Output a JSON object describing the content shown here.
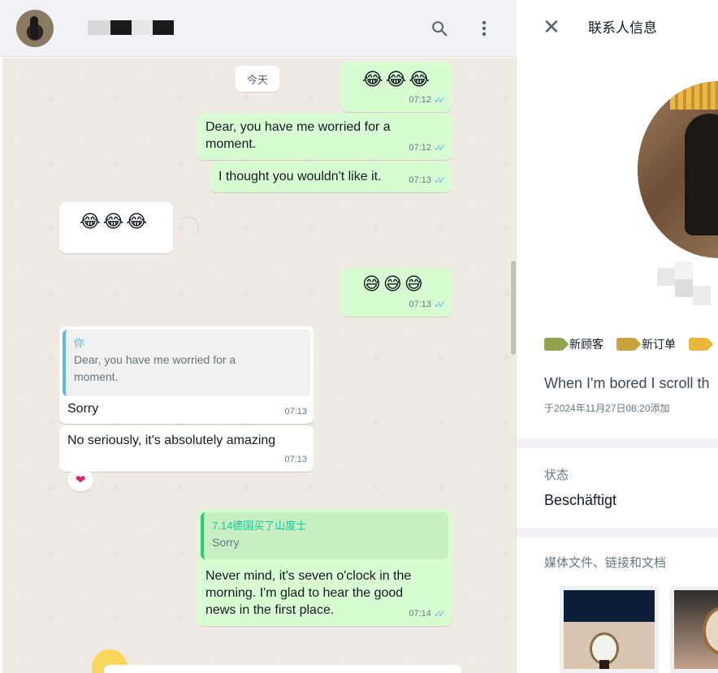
{
  "header": {
    "search_icon": "search-icon",
    "menu_icon": "more-vertical-icon"
  },
  "chat": {
    "date_chip": "今天",
    "messages": [
      {
        "direction": "out",
        "emoji": "😂😂😂",
        "time": "07:12"
      },
      {
        "direction": "out",
        "text": "Dear, you have me worried for a moment.",
        "time": "07:12"
      },
      {
        "direction": "out",
        "text": "I thought you wouldn't like it.",
        "time": "07:13"
      },
      {
        "direction": "in",
        "emoji": "😂😂😂"
      },
      {
        "direction": "out",
        "emoji": "😅😅😅",
        "time": "07:13"
      },
      {
        "direction": "in",
        "quote_author": "你",
        "quote_text": "Dear, you have me worried for a moment.",
        "text": "Sorry",
        "time": "07:13"
      },
      {
        "direction": "in",
        "text": "No seriously, it's absolutely amazing",
        "time": "07:13",
        "reaction": "❤"
      },
      {
        "direction": "out",
        "quote_author": "7.14德国买了山度士",
        "quote_text": "Sorry",
        "text": "Never mind, it's seven o'clock in the morning. I'm glad to hear the good news in the first place.",
        "time": "07:14"
      }
    ]
  },
  "contact_info": {
    "title": "联系人信息",
    "close_icon": "close-icon",
    "labels": [
      {
        "text": "新顾客",
        "color": "#8fa34a"
      },
      {
        "text": "新订单",
        "color": "#c9a43c"
      },
      {
        "text": "",
        "color": "#e8b63a"
      }
    ],
    "about": "When I'm bored I scroll th",
    "added_date": "于2024年11月27日08:20添加",
    "status_label": "状态",
    "status_value": "Beschäftigt",
    "media_label": "媒体文件、链接和文档"
  },
  "colors": {
    "outgoing_bubble": "#d9fdd3",
    "incoming_bubble": "#ffffff",
    "chat_background": "#efeae2",
    "read_ticks": "#53bdeb"
  }
}
